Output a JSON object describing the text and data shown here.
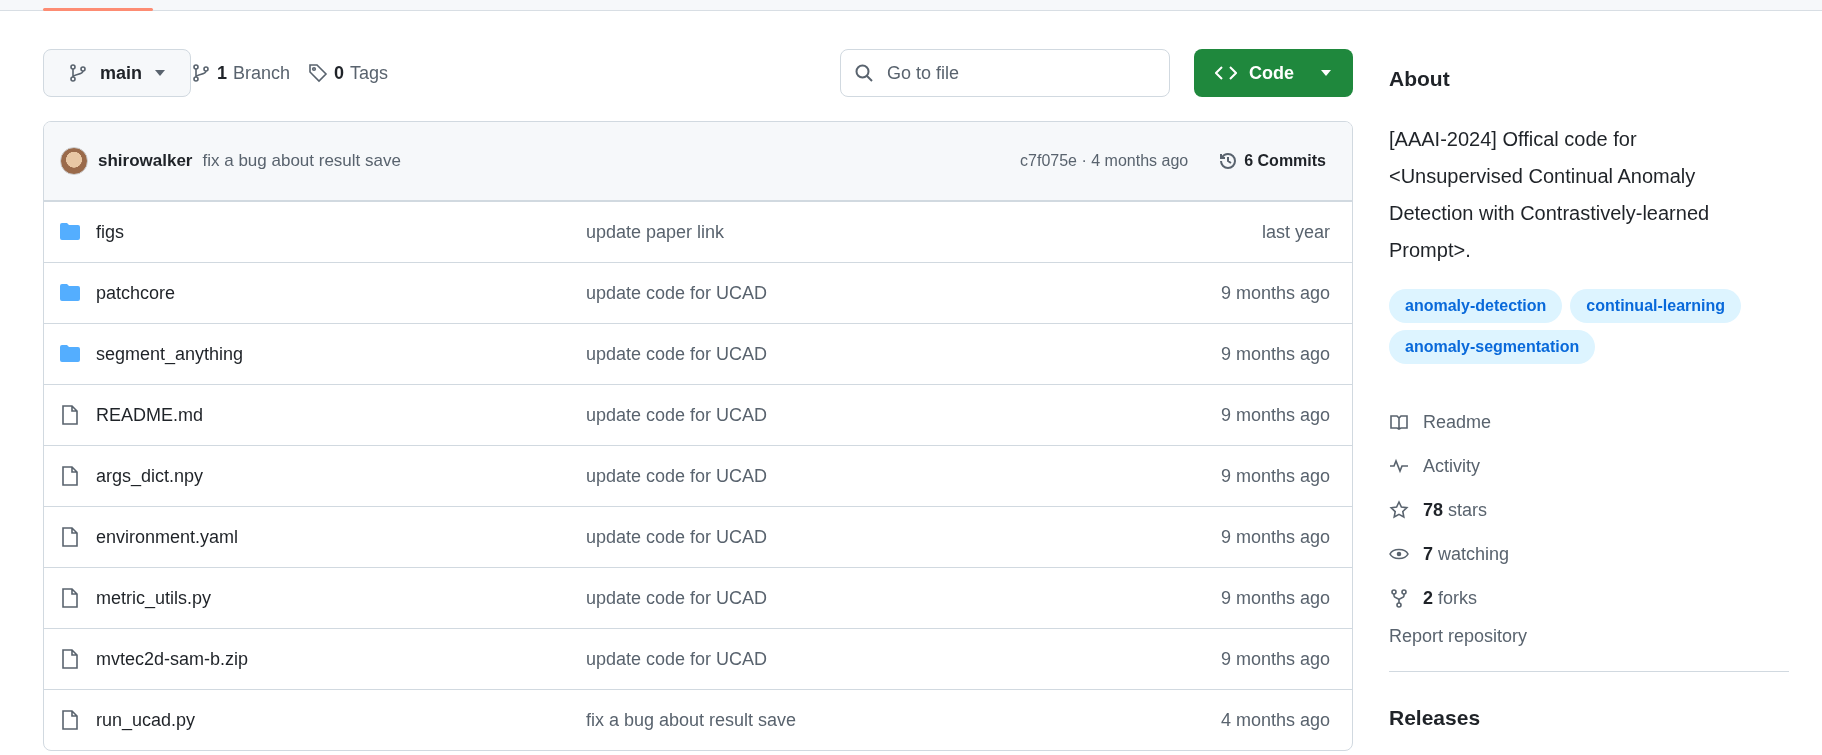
{
  "toolbar": {
    "branch": "main",
    "branch_count": "1",
    "branch_label": "Branch",
    "tag_count": "0",
    "tag_label": "Tags",
    "search": {
      "placeholder": "Go to file"
    },
    "code_button": "Code"
  },
  "latest_commit": {
    "author": "shirowalker",
    "message": "fix a bug about result save",
    "hash_time": "c7f075e · 4 months ago",
    "commits_count": "6",
    "commits_label": "Commits"
  },
  "files": [
    {
      "kind": "folder",
      "name": "figs",
      "message": "update paper link",
      "time": "last year"
    },
    {
      "kind": "folder",
      "name": "patchcore",
      "message": "update code for UCAD",
      "time": "9 months ago"
    },
    {
      "kind": "folder",
      "name": "segment_anything",
      "message": "update code for UCAD",
      "time": "9 months ago"
    },
    {
      "kind": "file",
      "name": "README.md",
      "message": "update code for UCAD",
      "time": "9 months ago"
    },
    {
      "kind": "file",
      "name": "args_dict.npy",
      "message": "update code for UCAD",
      "time": "9 months ago"
    },
    {
      "kind": "file",
      "name": "environment.yaml",
      "message": "update code for UCAD",
      "time": "9 months ago"
    },
    {
      "kind": "file",
      "name": "metric_utils.py",
      "message": "update code for UCAD",
      "time": "9 months ago"
    },
    {
      "kind": "file",
      "name": "mvtec2d-sam-b.zip",
      "message": "update code for UCAD",
      "time": "9 months ago"
    },
    {
      "kind": "file",
      "name": "run_ucad.py",
      "message": "fix a bug about result save",
      "time": "4 months ago"
    }
  ],
  "about": {
    "title": "About",
    "description": "[AAAI-2024] Offical code for <Unsupervised Continual Anomaly Detection with Contrastively-learned Prompt>.",
    "topics": [
      "anomaly-detection",
      "continual-learning",
      "anomaly-segmentation"
    ],
    "links": [
      {
        "kind": "readme",
        "label": "Readme"
      },
      {
        "kind": "activity",
        "label": "Activity"
      },
      {
        "kind": "stars",
        "count": "78",
        "label": "stars"
      },
      {
        "kind": "watching",
        "count": "7",
        "label": "watching"
      },
      {
        "kind": "forks",
        "count": "2",
        "label": "forks"
      }
    ],
    "report": "Report repository"
  },
  "releases": {
    "title": "Releases"
  }
}
